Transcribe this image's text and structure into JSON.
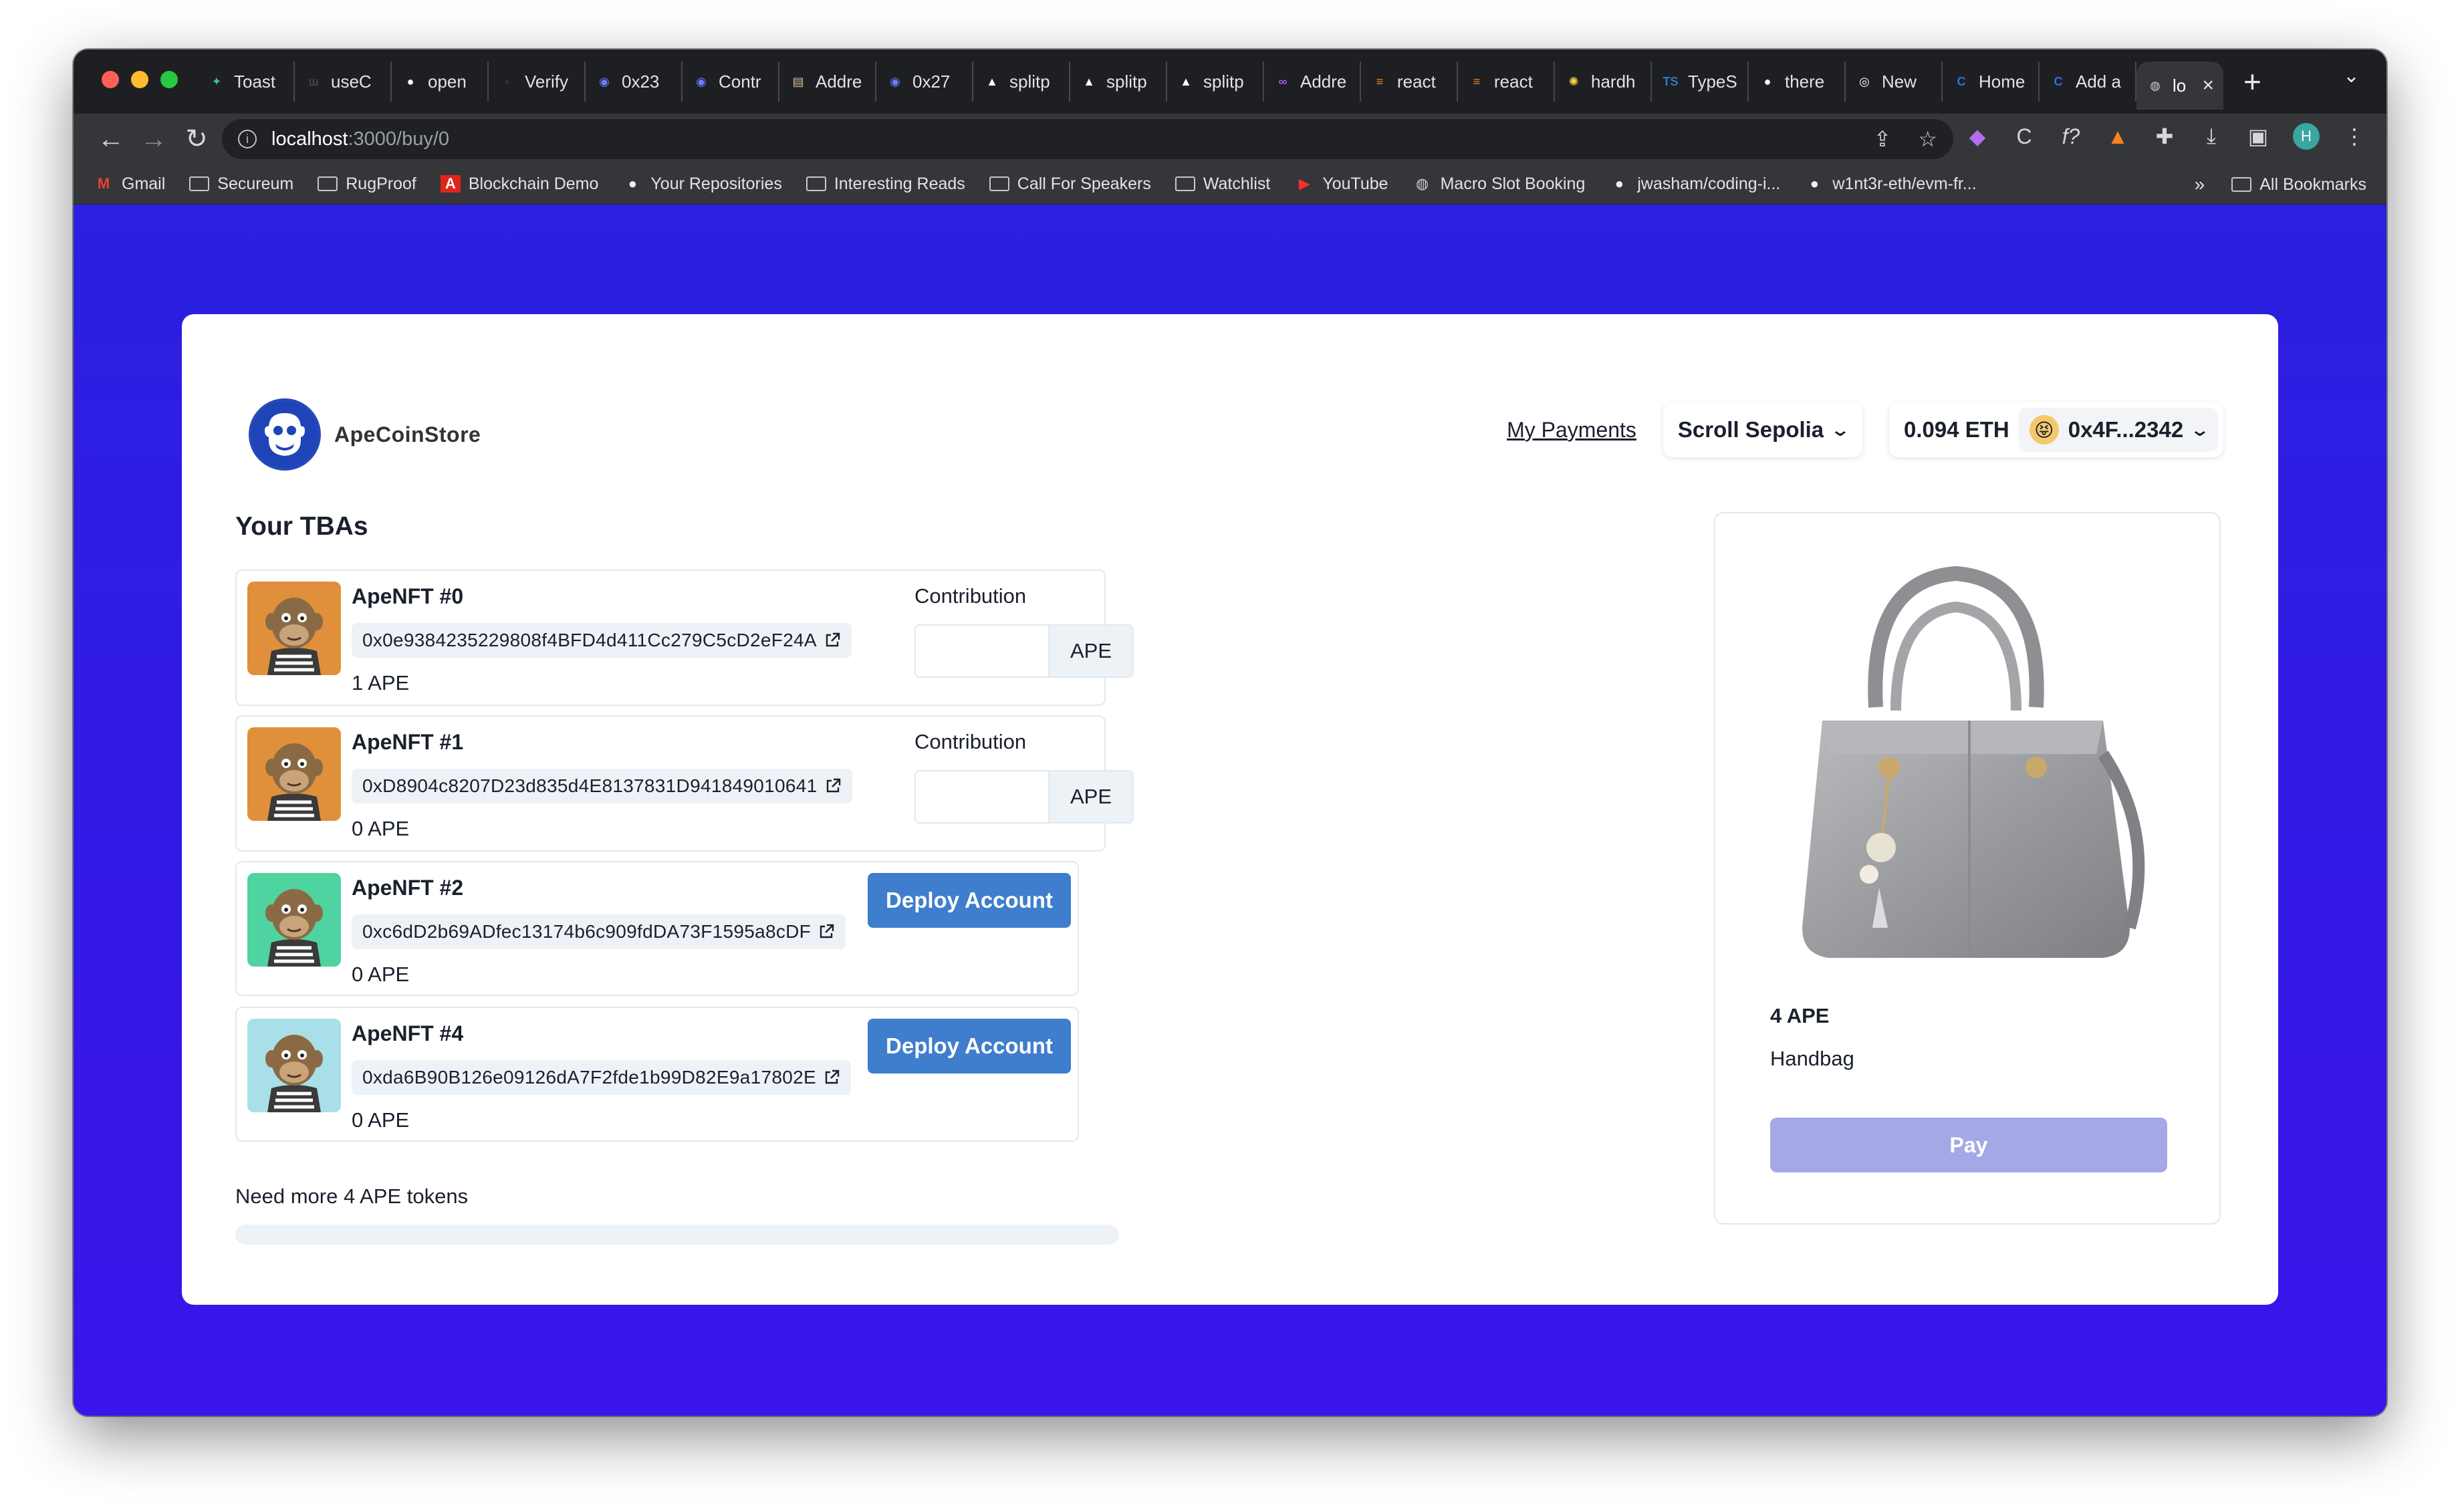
{
  "browser": {
    "tabs": [
      {
        "label": "Toast",
        "icon": "toast-favicon",
        "color": "#3bb8a5"
      },
      {
        "label": "useC",
        "icon": "usehooks-favicon",
        "color": "#444444"
      },
      {
        "label": "open",
        "icon": "github-favicon",
        "color": "#ffffff"
      },
      {
        "label": "Verify",
        "icon": "verify-favicon",
        "color": "#555555"
      },
      {
        "label": "0x23",
        "icon": "etherscan-favicon",
        "color": "#6b7cff"
      },
      {
        "label": "Contr",
        "icon": "etherscan-favicon",
        "color": "#6b7cff"
      },
      {
        "label": "Addre",
        "icon": "scroll-favicon",
        "color": "#d8c59a"
      },
      {
        "label": "0x27",
        "icon": "etherscan-favicon",
        "color": "#6b7cff"
      },
      {
        "label": "splitp",
        "icon": "vercel-favicon",
        "color": "#ffffff"
      },
      {
        "label": "splitp",
        "icon": "vercel-favicon",
        "color": "#ffffff"
      },
      {
        "label": "splitp",
        "icon": "vercel-favicon",
        "color": "#ffffff"
      },
      {
        "label": "Addre",
        "icon": "link-favicon",
        "color": "#a25bf0"
      },
      {
        "label": "react",
        "icon": "stackoverflow-favicon",
        "color": "#f48024"
      },
      {
        "label": "react",
        "icon": "stackoverflow-favicon",
        "color": "#f48024"
      },
      {
        "label": "hardh",
        "icon": "hardhat-favicon",
        "color": "#f5d547"
      },
      {
        "label": "TypeS",
        "icon": "typescript-favicon",
        "color": "#3178c6"
      },
      {
        "label": "there",
        "icon": "github-favicon",
        "color": "#ffffff"
      },
      {
        "label": "New",
        "icon": "chrome-favicon",
        "color": "#ffffff"
      },
      {
        "label": "Home",
        "icon": "coinbase-favicon",
        "color": "#2f6ee8"
      },
      {
        "label": "Add a",
        "icon": "coinbase-favicon",
        "color": "#2f6ee8"
      }
    ],
    "active_tab": {
      "label": "lo",
      "icon": "globe-favicon"
    },
    "address": {
      "host": "localhost",
      "path": ":3000/buy/0"
    },
    "bookmarks": [
      {
        "label": "Gmail",
        "icon": "gmail-icon"
      },
      {
        "label": "Secureum",
        "icon": "folder-icon"
      },
      {
        "label": "RugProof",
        "icon": "folder-icon"
      },
      {
        "label": "Blockchain Demo",
        "icon": "adobe-icon"
      },
      {
        "label": "Your Repositories",
        "icon": "github-icon"
      },
      {
        "label": "Interesting Reads",
        "icon": "folder-icon"
      },
      {
        "label": "Call For Speakers",
        "icon": "folder-icon"
      },
      {
        "label": "Watchlist",
        "icon": "folder-icon"
      },
      {
        "label": "YouTube",
        "icon": "youtube-icon"
      },
      {
        "label": "Macro Slot Booking",
        "icon": "globe-icon"
      },
      {
        "label": "jwasham/coding-i...",
        "icon": "github-icon"
      },
      {
        "label": "w1nt3r-eth/evm-fr...",
        "icon": "github-icon"
      }
    ],
    "bookmarks_more": "»",
    "all_bookmarks": "All Bookmarks",
    "profile_initial": "H"
  },
  "app": {
    "brand": "ApeCoinStore",
    "my_payments": "My Payments",
    "network": "Scroll Sepolia",
    "balance": "0.094 ETH",
    "account": "0x4F...2342",
    "account_avatar": "😝",
    "section_title": "Your TBAs",
    "tbas": [
      {
        "name": "ApeNFT #0",
        "address": "0x0e9384235229808f4BFD4d411Cc279C5cD2eF24A",
        "balance": "1 APE",
        "mode": "contribute",
        "contribution_label": "Contribution",
        "contribution_value": "",
        "unit": "APE",
        "bg": "#e0903a"
      },
      {
        "name": "ApeNFT #1",
        "address": "0xD8904c8207D23d835d4E8137831D941849010641",
        "balance": "0 APE",
        "mode": "contribute",
        "contribution_label": "Contribution",
        "contribution_value": "",
        "unit": "APE",
        "bg": "#e0903a"
      },
      {
        "name": "ApeNFT #2",
        "address": "0xc6dD2b69ADfec13174b6c909fdDA73F1595a8cDF",
        "balance": "0 APE",
        "mode": "deploy",
        "deploy_label": "Deploy Account",
        "bg": "#4fd3a1"
      },
      {
        "name": "ApeNFT #4",
        "address": "0xda6B90B126e09126dA7F2fde1b99D82E9a17802E",
        "balance": "0 APE",
        "mode": "deploy",
        "deploy_label": "Deploy Account",
        "bg": "#a8dfe8"
      }
    ],
    "need_more": "Need more 4 APE tokens",
    "progress_fraction": 0,
    "product": {
      "price": "4 APE",
      "name": "Handbag",
      "pay_label": "Pay"
    },
    "colors": {
      "primary": "#3e7ecc",
      "pay_disabled": "#a4a9e6",
      "page_bg": "#2b1fe0"
    }
  }
}
